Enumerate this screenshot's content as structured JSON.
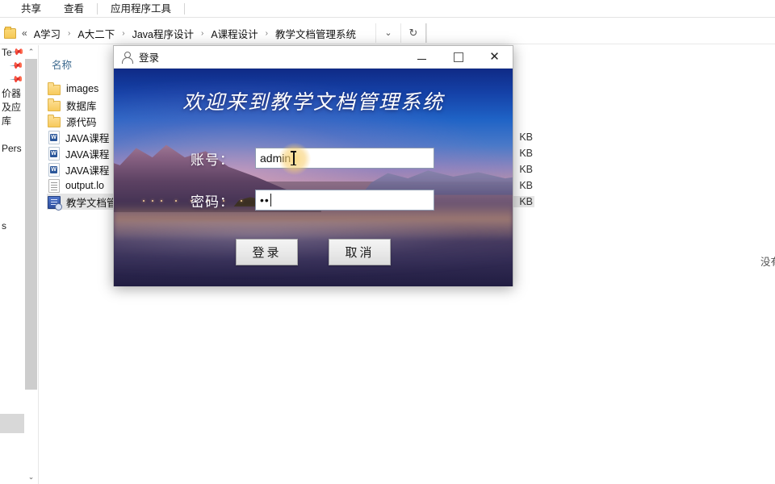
{
  "explorer": {
    "ribbon_tabs": [
      {
        "label": "共享"
      },
      {
        "label": "查看"
      },
      {
        "label": "应用程序工具"
      }
    ],
    "address": {
      "back_glyph": "«",
      "crumbs": [
        "A学习",
        "A大二下",
        "Java程序设计",
        "A课程设计",
        "教学文档管理系统"
      ],
      "separator": "›",
      "dropdown_glyph": "⌄",
      "refresh_glyph": "↻"
    },
    "nav_pane": {
      "items": [
        {
          "label": "Te",
          "pin": "📌"
        },
        {
          "label": "",
          "pin": "📌"
        },
        {
          "label": "",
          "pin": "📌"
        },
        {
          "label": "价器",
          "pin": ""
        },
        {
          "label": "及应",
          "pin": ""
        },
        {
          "label": "库",
          "pin": ""
        },
        {
          "label": "",
          "pin": ""
        },
        {
          "label": "Pers",
          "pin": ""
        }
      ],
      "bottom_label": "s",
      "scroll_up_glyph": "⌃",
      "scroll_down_glyph": "⌄"
    },
    "file_list": {
      "column_header": "名称",
      "size_unit": "KB",
      "rows": [
        {
          "name": "images",
          "icon": "folder-icon",
          "size": "",
          "selected": false
        },
        {
          "name": "数据库",
          "icon": "folder-icon",
          "size": "",
          "selected": false
        },
        {
          "name": "源代码",
          "icon": "folder-icon",
          "size": "",
          "selected": false
        },
        {
          "name": "JAVA课程",
          "icon": "word-doc-icon",
          "size": "KB",
          "selected": false
        },
        {
          "name": "JAVA课程",
          "icon": "word-doc-icon",
          "size": "KB",
          "selected": false
        },
        {
          "name": "JAVA课程",
          "icon": "word-doc-icon",
          "size": "KB",
          "selected": false
        },
        {
          "name": "output.lo",
          "icon": "text-file-icon",
          "size": "KB",
          "selected": false
        },
        {
          "name": "教学文档管",
          "icon": "jar-file-icon",
          "size": "KB",
          "selected": true
        }
      ]
    },
    "preview_pane": {
      "message": "没有"
    }
  },
  "dialog": {
    "title": "登录",
    "title_icon": "user-icon",
    "window_buttons": {
      "minimize": "minimize-icon",
      "maximize": "maximize-icon",
      "close": "close-icon"
    },
    "heading": "欢迎来到教学文档管理系统",
    "fields": [
      {
        "label": "账号：",
        "value": "admin",
        "name": "username"
      },
      {
        "label": "密码：",
        "value": "••",
        "name": "password"
      }
    ],
    "buttons": [
      {
        "label": "登录",
        "name": "login-button"
      },
      {
        "label": "取消",
        "name": "cancel-button"
      }
    ]
  },
  "colors": {
    "accent_blue": "#1f63c6",
    "sky_top": "#0f2a86",
    "selection_gray": "#e5e5e5",
    "column_header_blue": "#3d6a8f",
    "click_glow": "#fad678"
  }
}
